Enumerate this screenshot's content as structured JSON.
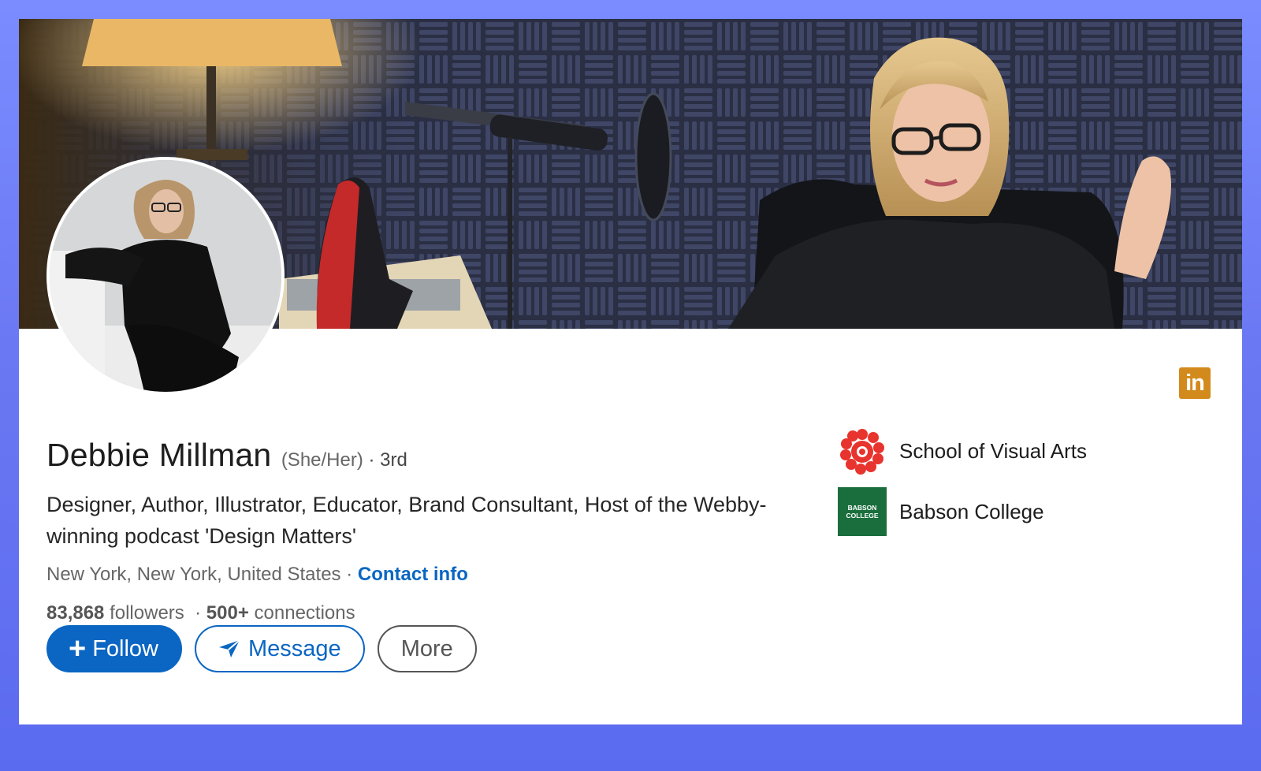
{
  "profile": {
    "name": "Debbie Millman",
    "pronouns": "(She/Her)",
    "degree_separator": " · ",
    "degree": "3rd",
    "headline": "Designer, Author, Illustrator, Educator, Brand Consultant, Host of the Webby-winning podcast 'Design Matters'",
    "location": "New York, New York, United States",
    "location_separator": " · ",
    "contact_info_label": "Contact info",
    "followers_count": "83,868",
    "followers_label": "followers",
    "connections_separator": "·",
    "connections_count": "500+",
    "connections_label": "connections"
  },
  "actions": {
    "follow_plus": "+",
    "follow_label": "Follow",
    "message_label": "Message",
    "more_label": "More"
  },
  "education": [
    {
      "name": "School of Visual Arts",
      "logo": "sva-flower-logo"
    },
    {
      "name": "Babson College",
      "logo": "babson-logo",
      "logo_line1": "BABSON",
      "logo_line2": "COLLEGE"
    }
  ],
  "icons": {
    "corner": "linkedin-icon",
    "corner_text": "in",
    "message": "send-paper-plane-icon"
  },
  "colors": {
    "background": "#6b78f3",
    "primary": "#0a66c2",
    "corner_icon": "#d38a1c",
    "babson_green": "#1a6e3d",
    "sva_red": "#e8342e"
  }
}
